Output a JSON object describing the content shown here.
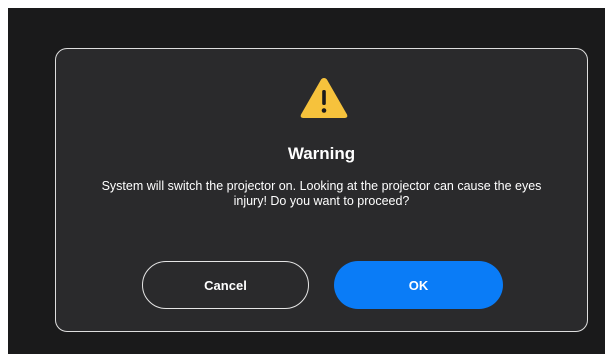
{
  "dialog": {
    "icon": "warning-icon",
    "icon_color": "#f6c23c",
    "title": "Warning",
    "message": "System will switch the projector on. Looking at the projector can cause the eyes injury! Do you want to proceed?",
    "cancel_label": "Cancel",
    "ok_label": "OK",
    "ok_color": "#0a7cf7"
  }
}
